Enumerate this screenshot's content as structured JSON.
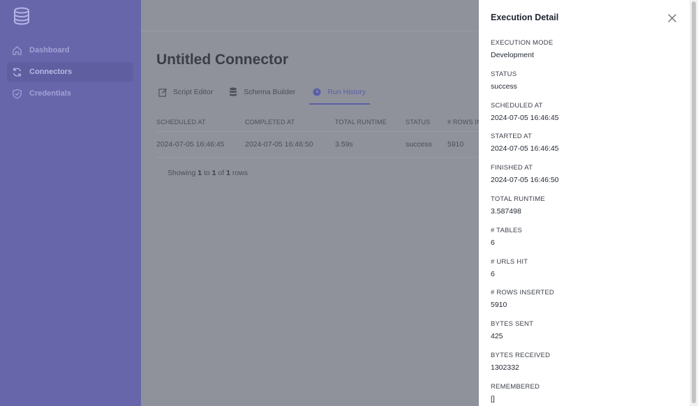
{
  "sidebar": {
    "items": [
      {
        "label": "Dashboard",
        "icon": "home-icon",
        "active": false
      },
      {
        "label": "Connectors",
        "icon": "refresh-icon",
        "active": true
      },
      {
        "label": "Credentials",
        "icon": "shield-icon",
        "active": false
      }
    ]
  },
  "main": {
    "title": "Untitled Connector",
    "tabs": [
      {
        "label": "Script Editor",
        "icon": "edit-icon"
      },
      {
        "label": "Schema Builder",
        "icon": "database-icon"
      },
      {
        "label": "Run History",
        "icon": "clock-icon",
        "active": true
      }
    ],
    "table": {
      "headers": [
        "SCHEDULED AT",
        "COMPLETED AT",
        "TOTAL RUNTIME",
        "STATUS",
        "# ROWS IN"
      ],
      "rows": [
        [
          "2024-07-05 16:46:45",
          "2024-07-05 16:46:50",
          "3.59s",
          "success",
          "5910"
        ]
      ]
    },
    "pager": {
      "prefix": "Showing ",
      "from": "1",
      "to_word": " to ",
      "to": "1",
      "of_word": " of ",
      "total": "1",
      "suffix": " rows"
    }
  },
  "drawer": {
    "title": "Execution Detail",
    "fields": [
      {
        "label": "EXECUTION MODE",
        "value": "Development"
      },
      {
        "label": "STATUS",
        "value": "success"
      },
      {
        "label": "SCHEDULED AT",
        "value": "2024-07-05 16:46:45"
      },
      {
        "label": "STARTED AT",
        "value": "2024-07-05 16:46:45"
      },
      {
        "label": "FINISHED AT",
        "value": "2024-07-05 16:46:50"
      },
      {
        "label": "TOTAL RUNTIME",
        "value": "3.587498"
      },
      {
        "label": "# TABLES",
        "value": "6"
      },
      {
        "label": "# URLS HIT",
        "value": "6"
      },
      {
        "label": "# ROWS INSERTED",
        "value": "5910"
      },
      {
        "label": "BYTES SENT",
        "value": "425"
      },
      {
        "label": "BYTES RECEIVED",
        "value": "1302332"
      },
      {
        "label": "REMEMBERED",
        "value": "[]"
      }
    ]
  },
  "colors": {
    "sidebar": "#6766ab",
    "overlay": "#8f929a",
    "accent": "#5b5ea8"
  }
}
